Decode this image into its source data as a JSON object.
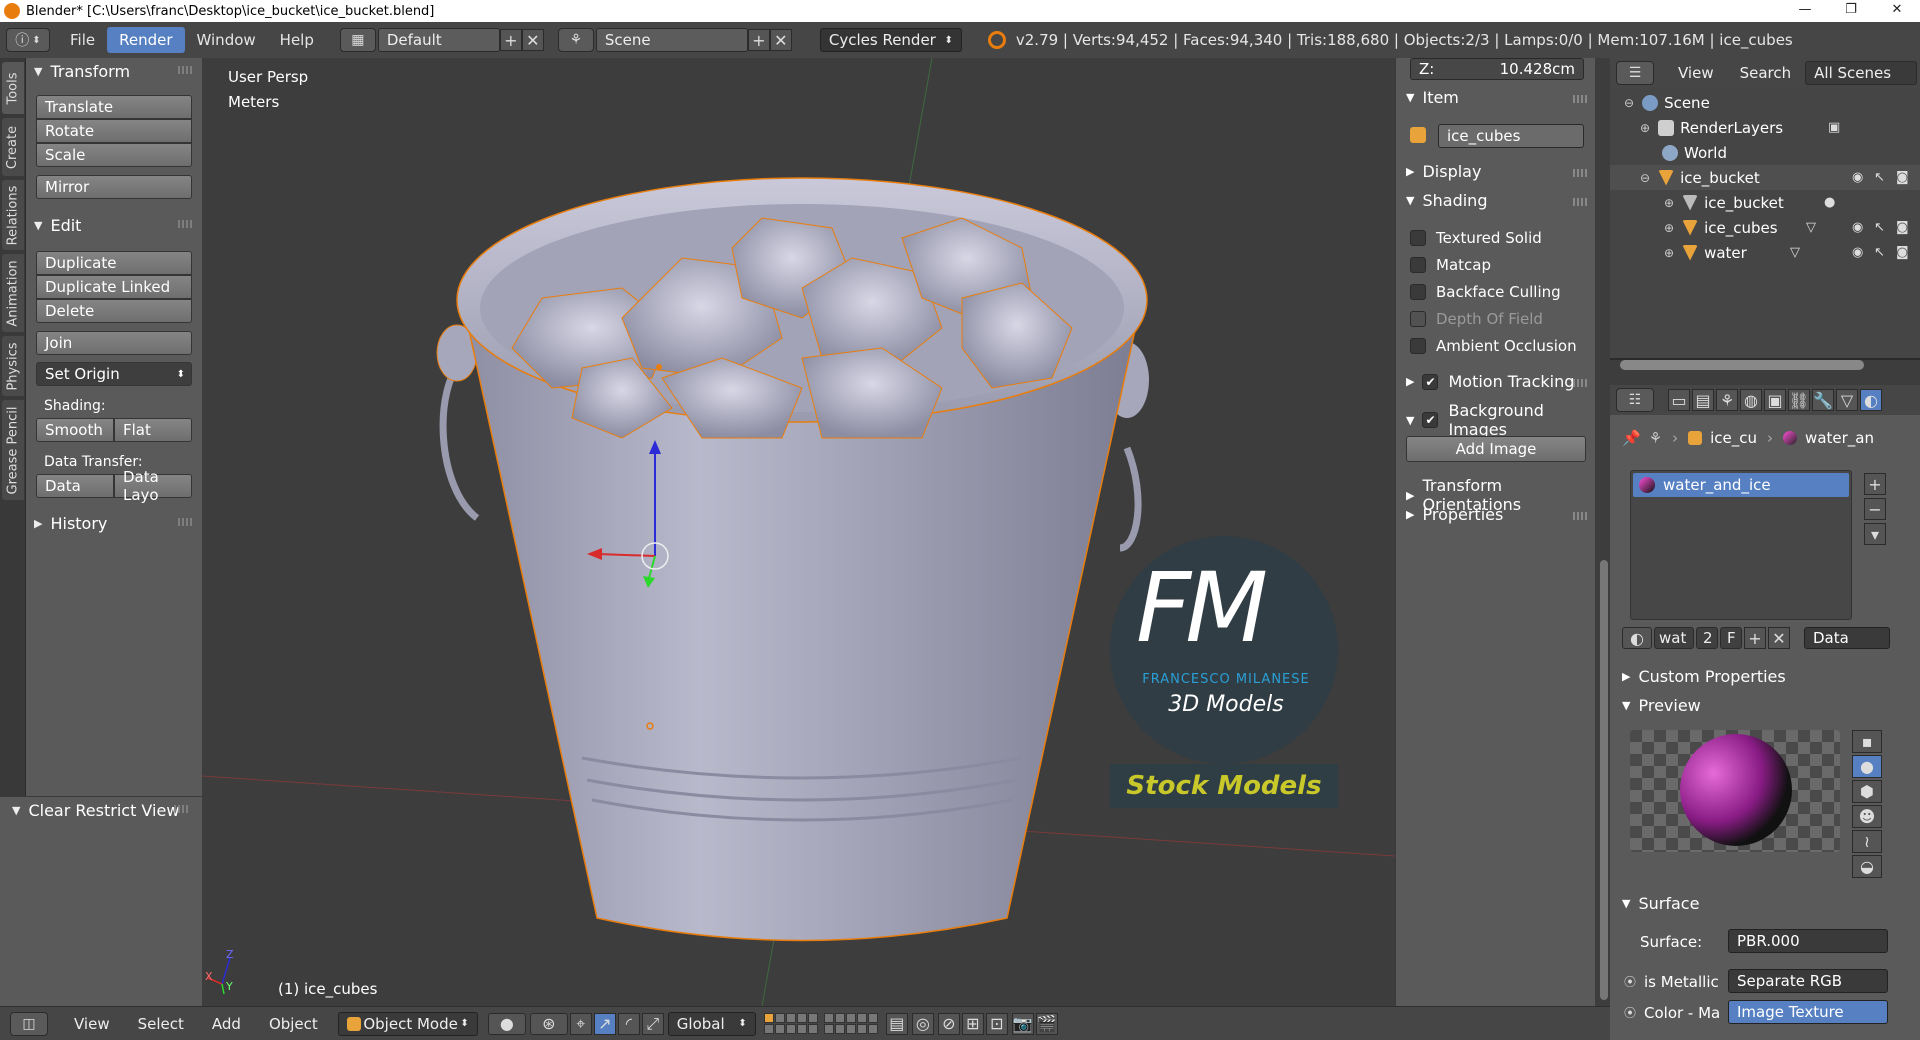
{
  "titlebar": {
    "title": "Blender* [C:\\Users\\franc\\Desktop\\ice_bucket\\ice_bucket.blend]",
    "minimize": "—",
    "restore": "❐",
    "close": "✕"
  },
  "info_header": {
    "menus": [
      "File",
      "Render",
      "Window",
      "Help"
    ],
    "active_menu": "Render",
    "screen_layout": "Default",
    "scene": "Scene",
    "render_engine": "Cycles Render",
    "stats": "v2.79 | Verts:94,452 | Faces:94,340 | Tris:188,680 | Objects:2/3 | Lamps:0/0 | Mem:107.16M | ice_cubes"
  },
  "tool_tabs": [
    "Tools",
    "Create",
    "Relations",
    "Animation",
    "Physics",
    "Grease Pencil"
  ],
  "toolshelf": {
    "transform_title": "Transform",
    "translate": "Translate",
    "rotate": "Rotate",
    "scale": "Scale",
    "mirror": "Mirror",
    "edit_title": "Edit",
    "duplicate": "Duplicate",
    "duplicate_linked": "Duplicate Linked",
    "delete": "Delete",
    "join": "Join",
    "set_origin": "Set Origin",
    "shading_label": "Shading:",
    "smooth": "Smooth",
    "flat": "Flat",
    "data_transfer_label": "Data Transfer:",
    "data": "Data",
    "data_layout": "Data Layo",
    "history_title": "History",
    "clear_restrict_view": "Clear Restrict View"
  },
  "viewport": {
    "view_name": "User Persp",
    "units": "Meters",
    "selected_info": "(1) ice_cubes",
    "watermark": {
      "logo_letters": "FM",
      "brand": "FRANCESCO MILANESE",
      "subtitle": "3D Models",
      "banner": "Stock Models"
    },
    "axis_z": "Z",
    "axis_x": "X",
    "axis_y": "Y"
  },
  "npanel": {
    "z_label": "Z:",
    "z_value": "10.428cm",
    "item_title": "Item",
    "item_name": "ice_cubes",
    "display_title": "Display",
    "shading_title": "Shading",
    "textured_solid": "Textured Solid",
    "matcap": "Matcap",
    "backface_culling": "Backface Culling",
    "depth_of_field": "Depth Of Field",
    "ambient_occlusion": "Ambient Occlusion",
    "motion_tracking": "Motion Tracking",
    "background_images": "Background Images",
    "add_image": "Add Image",
    "transform_orientations": "Transform Orientations",
    "properties": "Properties"
  },
  "outliner": {
    "view": "View",
    "search": "Search",
    "filter": "All Scenes",
    "rows": [
      {
        "label": "Scene"
      },
      {
        "label": "RenderLayers"
      },
      {
        "label": "World"
      },
      {
        "label": "ice_bucket"
      },
      {
        "label": "ice_bucket"
      },
      {
        "label": "ice_cubes"
      },
      {
        "label": "water"
      }
    ]
  },
  "properties": {
    "breadcrumb_object": "ice_cu",
    "breadcrumb_material": "water_an",
    "material_slot": "water_and_ice",
    "mat_name_short": "wat",
    "users": "2",
    "fake_user": "F",
    "link": "Data",
    "custom_properties": "Custom Properties",
    "preview": "Preview",
    "surface_title": "Surface",
    "surface_label": "Surface:",
    "surface_value": "PBR.000",
    "is_metallic_label": "is Metallic",
    "is_metallic_value": "Separate RGB",
    "color_label": "Color - Ma",
    "color_value": "Image Texture"
  },
  "bottom_header": {
    "menus": [
      "View",
      "Select",
      "Add",
      "Object"
    ],
    "mode": "Object Mode",
    "orientation": "Global"
  },
  "colors": {
    "accent_blue": "#5680c2",
    "selection_orange": "#e87d0d",
    "brand_blue": "#2a9fd6",
    "brand_yellow": "#c8c82a"
  }
}
